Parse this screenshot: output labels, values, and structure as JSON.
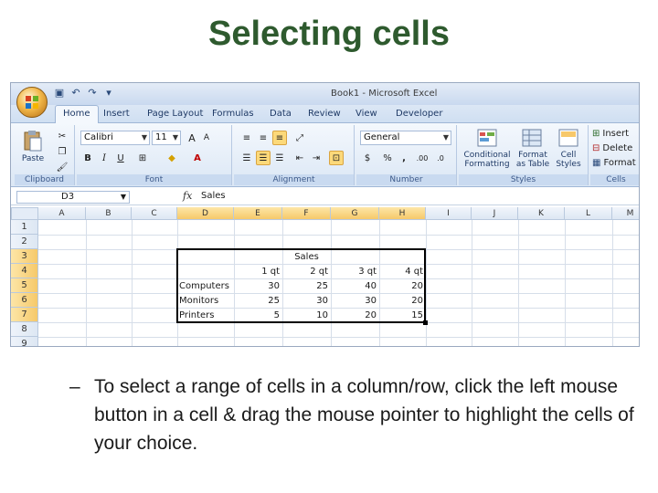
{
  "slide": {
    "title": "Selecting cells",
    "bullet_dash": "–",
    "bullet": "To select a range of cells in a column/row, click the left mouse button in a cell & drag the mouse pointer to highlight the cells of your choice."
  },
  "excel": {
    "window_title": "Book1 - Microsoft Excel",
    "tabs": [
      "Home",
      "Insert",
      "Page Layout",
      "Formulas",
      "Data",
      "Review",
      "View",
      "Developer"
    ],
    "active_tab": "Home",
    "ribbon": {
      "clipboard": {
        "label": "Clipboard",
        "paste": "Paste"
      },
      "font": {
        "label": "Font",
        "font_name": "Calibri",
        "font_size": "11",
        "bold": "B",
        "italic": "I",
        "underline": "U"
      },
      "alignment": {
        "label": "Alignment"
      },
      "number": {
        "label": "Number",
        "format": "General",
        "currency": "$",
        "percent": "%",
        "comma": ",",
        "inc_decimal": ".00",
        "dec_decimal": ".0"
      },
      "styles": {
        "label": "Styles",
        "conditional": "Conditional Formatting",
        "format_table": "Format as Table",
        "cell_styles": "Cell Styles"
      },
      "cells": {
        "label": "Cells",
        "insert": "Insert",
        "delete": "Delete",
        "format": "Format"
      }
    },
    "formula_bar": {
      "name_box": "D3",
      "fx": "fx",
      "content": "Sales"
    },
    "columns": [
      "A",
      "B",
      "C",
      "D",
      "E",
      "F",
      "G",
      "H",
      "I",
      "J",
      "K",
      "L",
      "M"
    ],
    "rows": [
      "1",
      "2",
      "3",
      "4",
      "5",
      "6",
      "7",
      "8",
      "9"
    ],
    "sheet": {
      "title": "Sales",
      "headers": [
        "1 qt",
        "2 qt",
        "3 qt",
        "4 qt"
      ],
      "data": [
        {
          "label": "Computers",
          "values": [
            "30",
            "25",
            "40",
            "20"
          ]
        },
        {
          "label": "Monitors",
          "values": [
            "25",
            "30",
            "30",
            "20"
          ]
        },
        {
          "label": "Printers",
          "values": [
            "5",
            "10",
            "20",
            "15"
          ]
        }
      ]
    },
    "colors": {
      "selection": "#000000",
      "header_highlight": "#f6c96a",
      "title": "#2e5a2e"
    }
  }
}
